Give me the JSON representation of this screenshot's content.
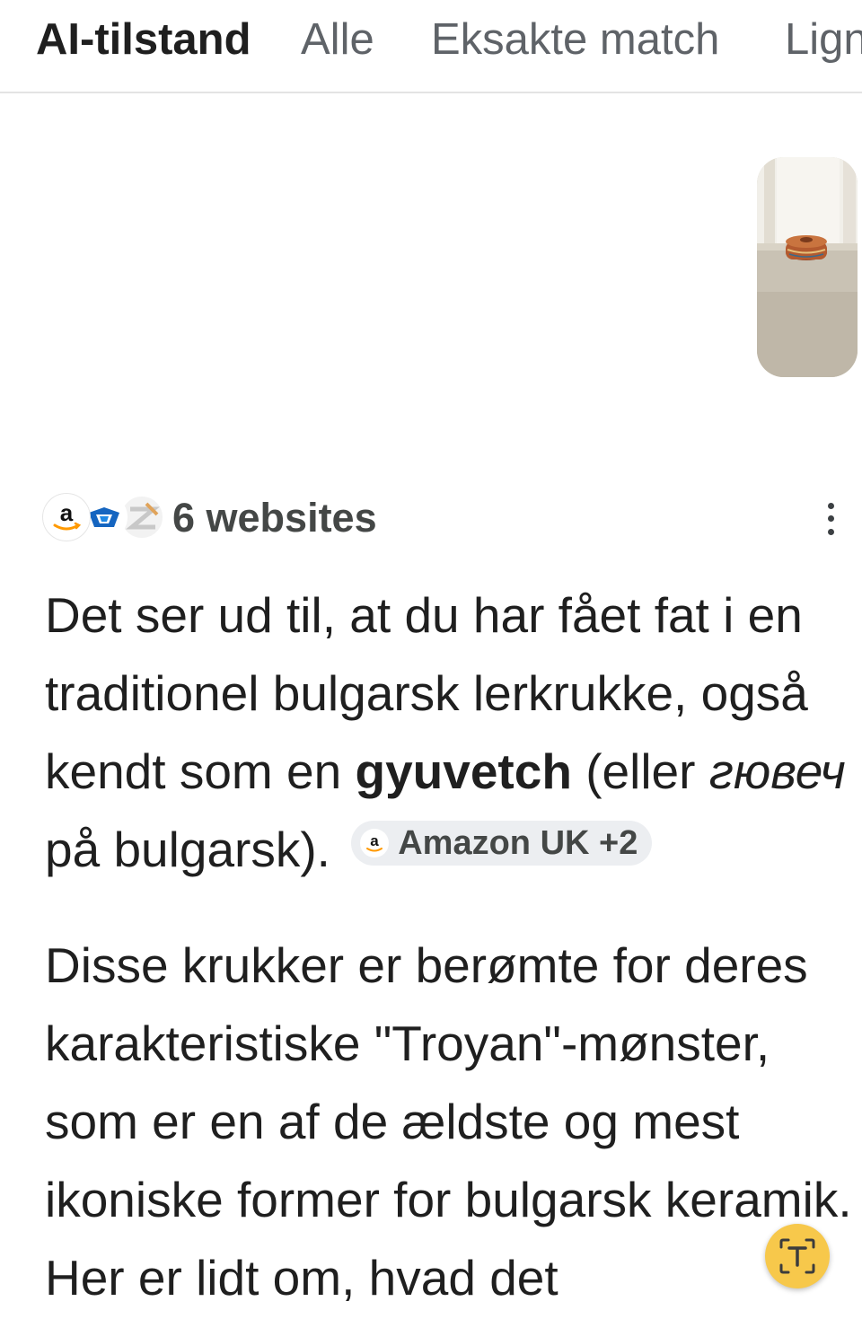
{
  "tabs": [
    {
      "label": "AI-tilstand",
      "active": true
    },
    {
      "label": "Alle",
      "active": false
    },
    {
      "label": "Eksakte match",
      "active": false
    },
    {
      "label": "Lign",
      "active": false
    }
  ],
  "sources": {
    "count_label": "6 websites",
    "favicons": [
      "amazon-icon",
      "store-icon",
      "site-icon"
    ]
  },
  "answer": {
    "p1": {
      "text_a": "Det ser ud til, at du har fået fat i en traditionel bulgarsk lerkrukke, også kendt som en ",
      "bold": "gyuvetch",
      "text_b": " (eller ",
      "italic": "гювеч",
      "text_c": " på bulgarsk).",
      "citation": {
        "label": "Amazon UK +2",
        "icon": "amazon-icon"
      }
    },
    "p2": "Disse krukker er berømte for deres karakteristiske \"Troyan\"-mønster, som er en af de ældste og mest ikoniske former for bulgarsk keramik. Her er lidt om, hvad det"
  },
  "colors": {
    "text": "#1f1f1f",
    "muted": "#5f6368",
    "chip_bg": "#eceef1",
    "fab": "#f7c84b",
    "amazon_orange": "#ff9900"
  },
  "fab": {
    "icon": "translate-icon"
  }
}
